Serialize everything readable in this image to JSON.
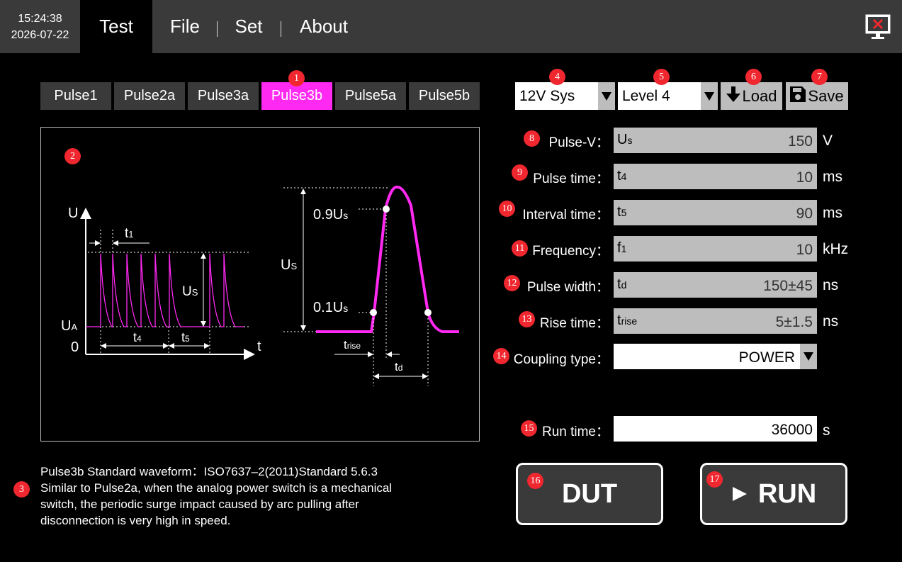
{
  "clock": {
    "time": "15:24:38",
    "date": "2026-07-22"
  },
  "menu": [
    {
      "label": "Test",
      "active": true
    },
    {
      "label": "File",
      "active": false
    },
    {
      "label": "Set",
      "active": false
    },
    {
      "label": "About",
      "active": false
    }
  ],
  "pulse_tabs": [
    {
      "label": "Pulse1",
      "active": false
    },
    {
      "label": "Pulse2a",
      "active": false
    },
    {
      "label": "Pulse3a",
      "active": false
    },
    {
      "label": "Pulse3b",
      "active": true
    },
    {
      "label": "Pulse5a",
      "active": false
    },
    {
      "label": "Pulse5b",
      "active": false
    }
  ],
  "waveform": {
    "left": {
      "u_axis": "U",
      "u_a_main": "U",
      "u_a_sub": "A",
      "zero": "0",
      "t_axis": "t",
      "t1_main": "t",
      "t1_sub": "1",
      "us_main": "U",
      "us_sub": "S",
      "t4_main": "t",
      "t4_sub": "4",
      "t5_main": "t",
      "t5_sub": "5"
    },
    "right": {
      "us_main": "U",
      "us_sub": "S",
      "p09_main": "0.9U",
      "p09_sub": "s",
      "p01_main": "0.1U",
      "p01_sub": "s",
      "trise_main": "t",
      "trise_sub": "rise",
      "td_main": "t",
      "td_sub": "d"
    },
    "accent": "#ff29f2"
  },
  "description": {
    "line1": "Pulse3b Standard waveform：ISO7637–2(2011)Standard 5.6.3",
    "line2": "Similar to Pulse2a, when the analog power switch is a mechanical",
    "line3": "switch, the periodic surge impact caused by arc pulling after",
    "line4": "disconnection is very high in speed."
  },
  "badges": [
    "1",
    "2",
    "3",
    "4",
    "5",
    "6",
    "7",
    "8",
    "9",
    "10",
    "11",
    "12",
    "13",
    "14",
    "15",
    "16",
    "17"
  ],
  "system_select": {
    "value": "12V Sys"
  },
  "level_select": {
    "value": "Level 4"
  },
  "load_button": {
    "label": "Load"
  },
  "save_button": {
    "label": "Save"
  },
  "params": [
    {
      "label": "Pulse-V：",
      "sym_main": "U",
      "sym_sub": "s",
      "value": "150",
      "unit": "V"
    },
    {
      "label": "Pulse time：",
      "sym_main": "t",
      "sym_sub": "4",
      "value": "10",
      "unit": "ms"
    },
    {
      "label": "Interval time：",
      "sym_main": "t",
      "sym_sub": "5",
      "value": "90",
      "unit": "ms"
    },
    {
      "label": "Frequency：",
      "sym_main": "f",
      "sym_sub": "1",
      "value": "10",
      "unit": "kHz"
    },
    {
      "label": "Pulse width：",
      "sym_main": "t",
      "sym_sub": "d",
      "value": "150±45",
      "unit": "ns"
    },
    {
      "label": "Rise time：",
      "sym_main": "t",
      "sym_sub": "rise",
      "value": "5±1.5",
      "unit": "ns"
    }
  ],
  "coupling": {
    "label": "Coupling type：",
    "value": "POWER"
  },
  "run_time": {
    "label": "Run time：",
    "value": "36000",
    "unit": "s"
  },
  "dut_button": {
    "label": "DUT"
  },
  "run_button": {
    "label": "RUN"
  },
  "colors": {
    "accent": "#ff29f2",
    "badge": "#f0272f",
    "field": "#bdbdbd",
    "bar": "#3a3a3a"
  }
}
